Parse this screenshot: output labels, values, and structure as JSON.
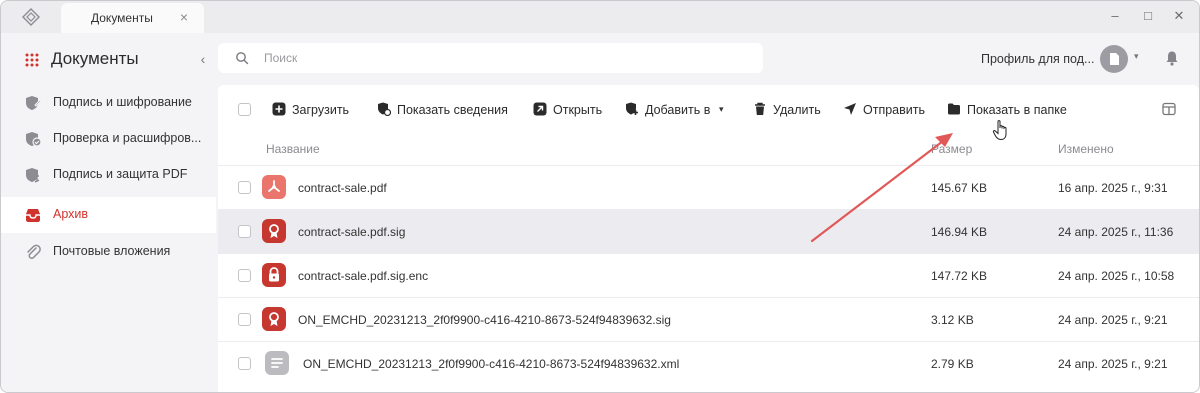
{
  "window": {
    "tab_title": "Документы",
    "tab_close_glyph": "×",
    "controls": {
      "minimize": "–",
      "maximize": "□",
      "close": "✕"
    }
  },
  "sidebar": {
    "title": "Документы",
    "collapse_glyph": "‹",
    "items": [
      {
        "label": "Подпись и шифрование",
        "icon": "shield-pen-icon",
        "active": false
      },
      {
        "label": "Проверка и расшифров...",
        "icon": "shield-check-icon",
        "active": false
      },
      {
        "label": "Подпись и защита PDF",
        "icon": "shield-pdf-icon",
        "active": false
      },
      {
        "label": "Архив",
        "icon": "archive-icon",
        "active": true
      },
      {
        "label": "Почтовые вложения",
        "icon": "paperclip-icon",
        "active": false
      }
    ]
  },
  "header": {
    "search_placeholder": "Поиск",
    "profile_name": "Профиль для под...",
    "caret": "▾"
  },
  "toolbar": {
    "upload": "Загрузить",
    "show_info": "Показать сведения",
    "open": "Открыть",
    "add_to": "Добавить в",
    "add_caret": "▾",
    "delete": "Удалить",
    "send": "Отправить",
    "show_in_folder": "Показать в папке"
  },
  "table": {
    "columns": {
      "name": "Название",
      "size": "Размер",
      "modified": "Изменено"
    },
    "rows": [
      {
        "name": "contract-sale.pdf",
        "size": "145.67 KB",
        "date": "16 апр. 2025 г., 9:31",
        "type": "pdf",
        "selected": false
      },
      {
        "name": "contract-sale.pdf.sig",
        "size": "146.94 KB",
        "date": "24 апр. 2025 г., 11:36",
        "type": "sig",
        "selected": true
      },
      {
        "name": "contract-sale.pdf.sig.enc",
        "size": "147.72 KB",
        "date": "24 апр. 2025 г., 10:58",
        "type": "enc",
        "selected": false
      },
      {
        "name": "ON_EMCHD_20231213_2f0f9900-c416-4210-8673-524f94839632.sig",
        "size": "3.12 KB",
        "date": "24 апр. 2025 г., 9:21",
        "type": "sig",
        "selected": false
      },
      {
        "name": "ON_EMCHD_20231213_2f0f9900-c416-4210-8673-524f94839632.xml",
        "size": "2.79 KB",
        "date": "24 апр. 2025 г., 9:21",
        "type": "xml",
        "selected": false
      }
    ]
  },
  "colors": {
    "accent_red": "#d0332d",
    "pdf_icon": "#e9756d",
    "sig_icon": "#c5372f",
    "xml_icon": "#bcbcc0",
    "arrow": "#e05858"
  }
}
